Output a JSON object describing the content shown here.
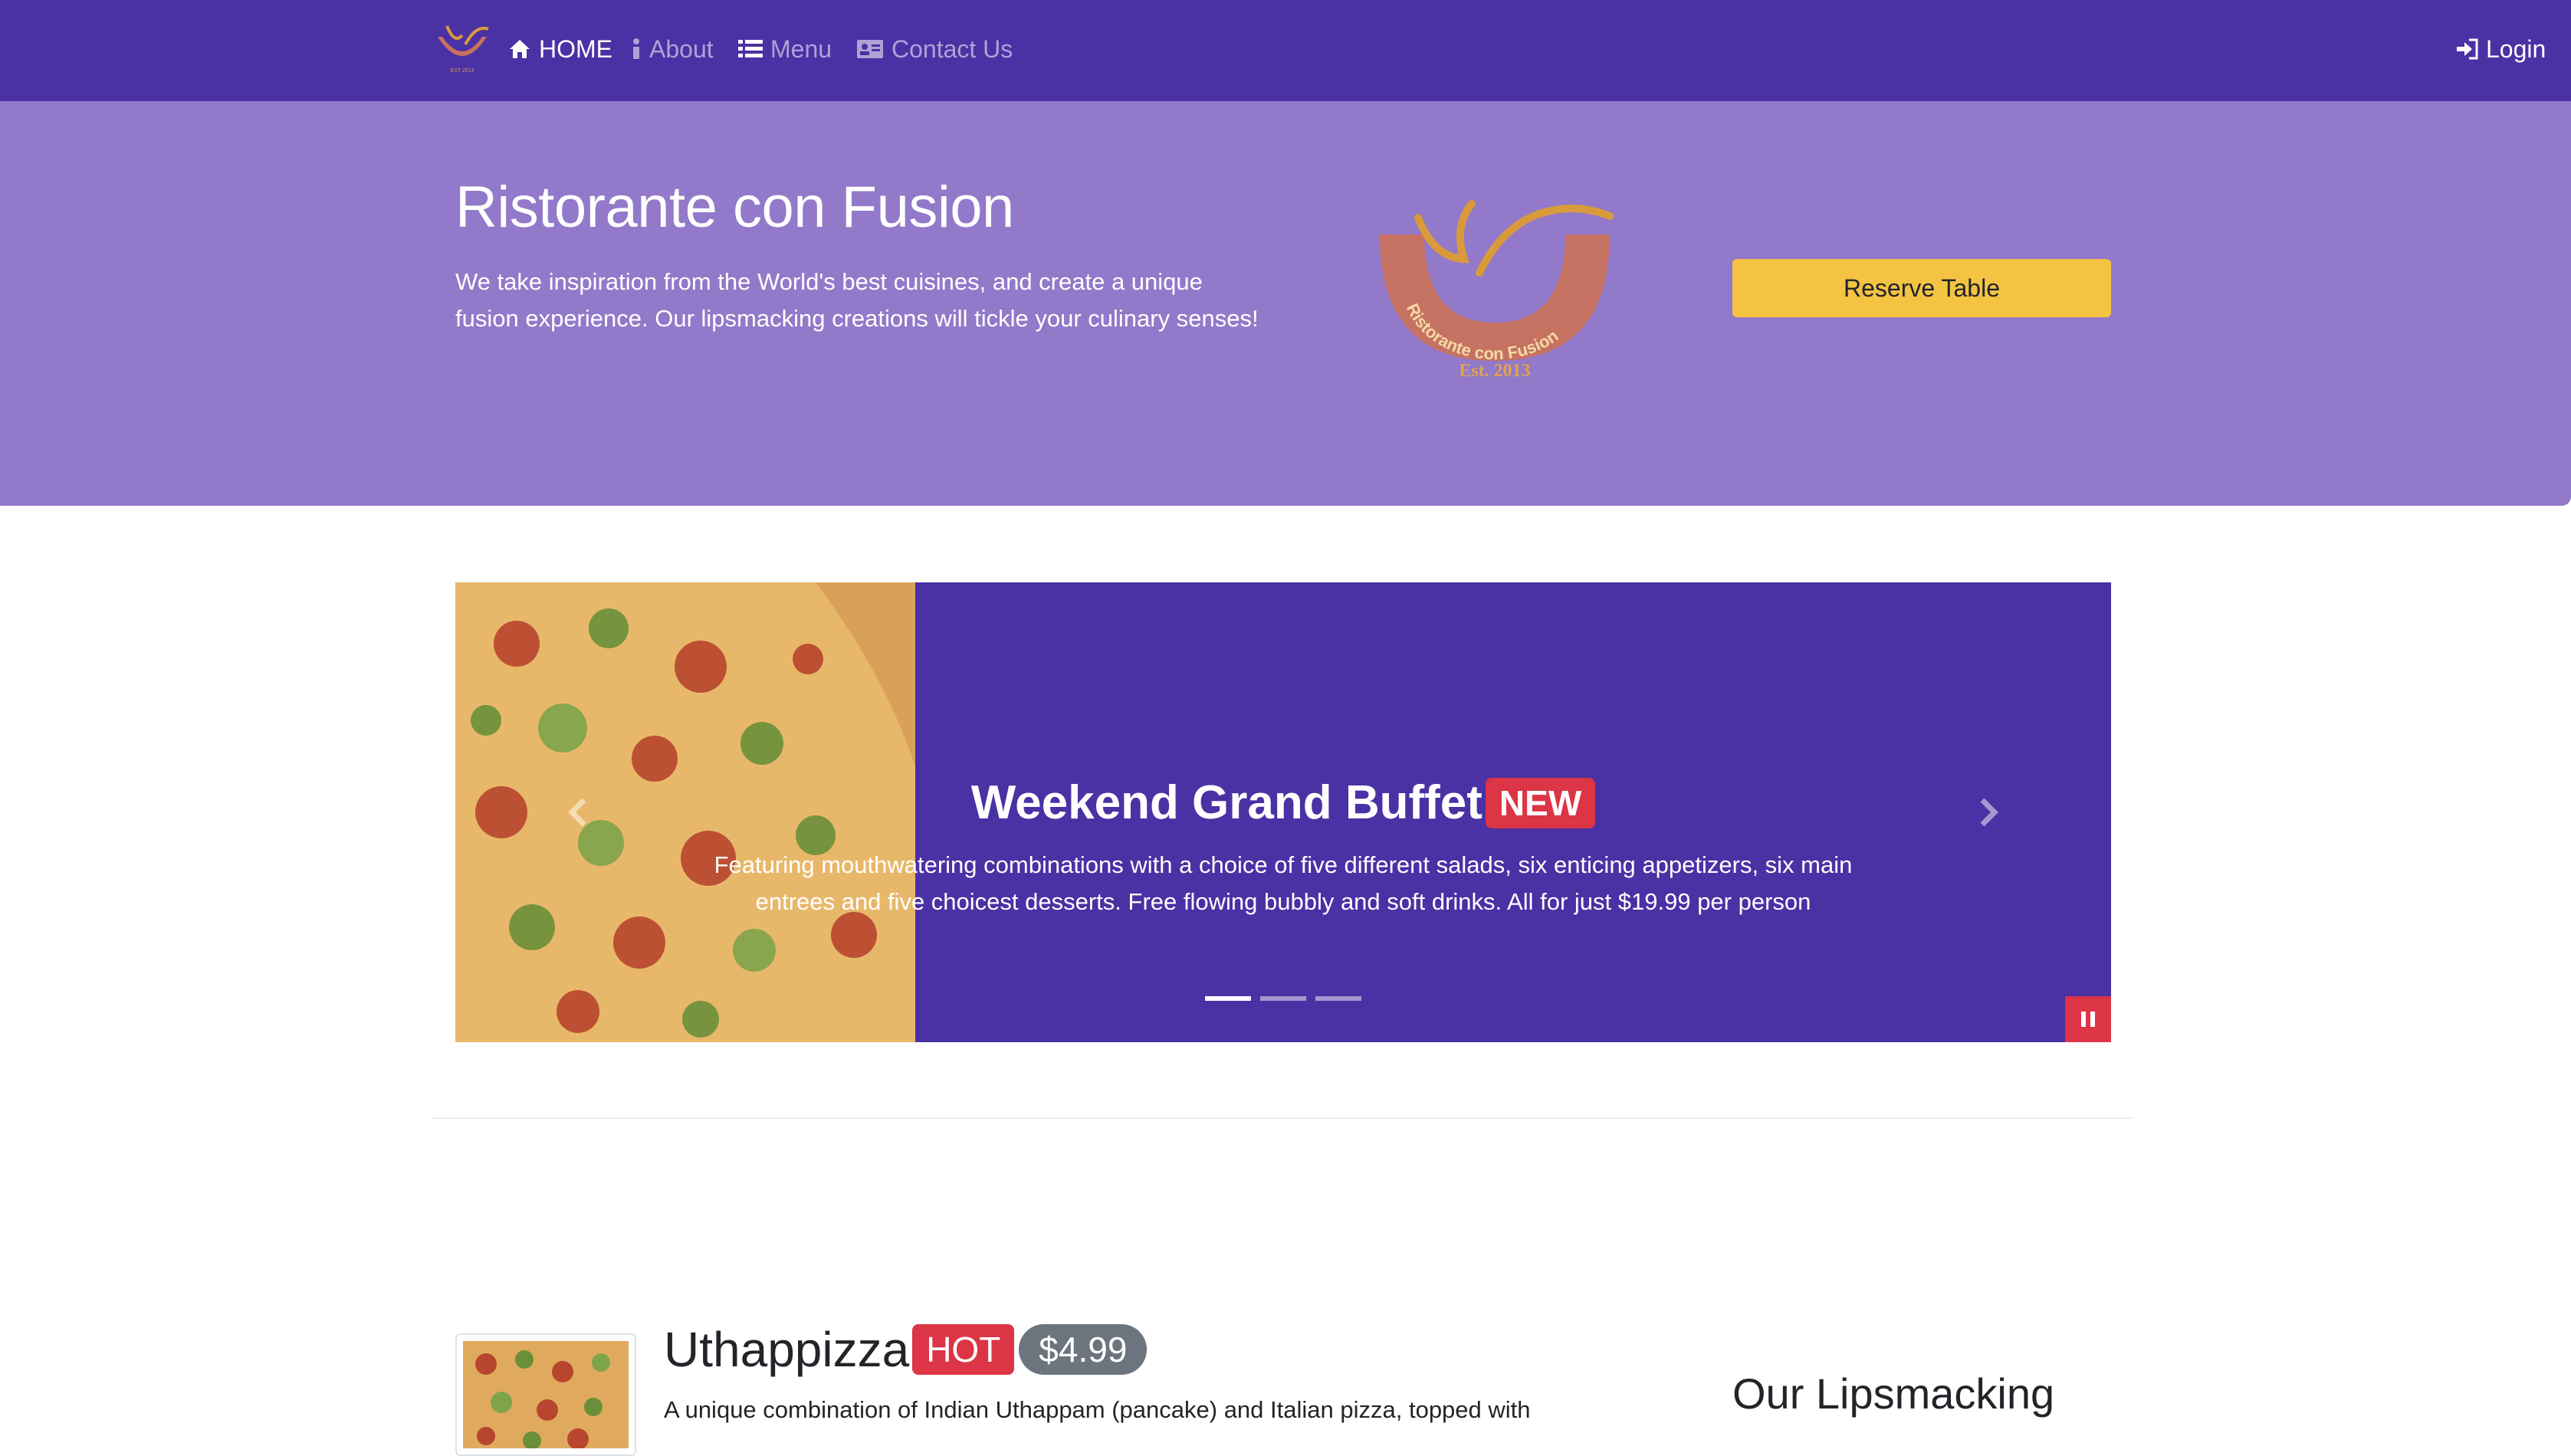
{
  "colors": {
    "navbar": "#4a31a4",
    "jumbotron": "#9279c9",
    "accent_yellow": "#f5c342",
    "badge_red": "#dc3545",
    "badge_gray": "#6c757d",
    "carousel_bg": "#4a31a4"
  },
  "nav": {
    "brand_icon": "restaurant-logo",
    "items": [
      {
        "label": "HOME",
        "icon": "home-icon",
        "active": true
      },
      {
        "label": "About",
        "icon": "info-icon",
        "active": false
      },
      {
        "label": "Menu",
        "icon": "list-icon",
        "active": false
      },
      {
        "label": "Contact Us",
        "icon": "address-card-icon",
        "active": false
      }
    ],
    "login": {
      "label": "Login",
      "icon": "sign-in-icon"
    }
  },
  "jumbotron": {
    "title": "Ristorante con Fusion",
    "text": "We take inspiration from the World's best cuisines, and create a unique fusion experience. Our lipsmacking creations will tickle your culinary senses!",
    "logo_text": "Ristorante con Fusion",
    "logo_est": "Est. 2013",
    "reserve_label": "Reserve Table"
  },
  "carousel": {
    "title": "Weekend Grand Buffet",
    "badge": "NEW",
    "text": "Featuring mouthwatering combinations with a choice of five different salads, six enticing appetizers, six main entrees and five choicest desserts. Free flowing bubbly and soft drinks. All for just $19.99 per person",
    "indicators": 3,
    "active_indicator": 0,
    "prev_icon": "chevron-left-icon",
    "next_icon": "chevron-right-icon",
    "pause_icon": "pause-icon"
  },
  "featured": {
    "title": "Uthappizza",
    "badge_hot": "HOT",
    "price": "$4.99",
    "text": "A unique combination of Indian Uthappam (pancake) and Italian pizza, topped with"
  },
  "side": {
    "title": "Our Lipsmacking"
  }
}
